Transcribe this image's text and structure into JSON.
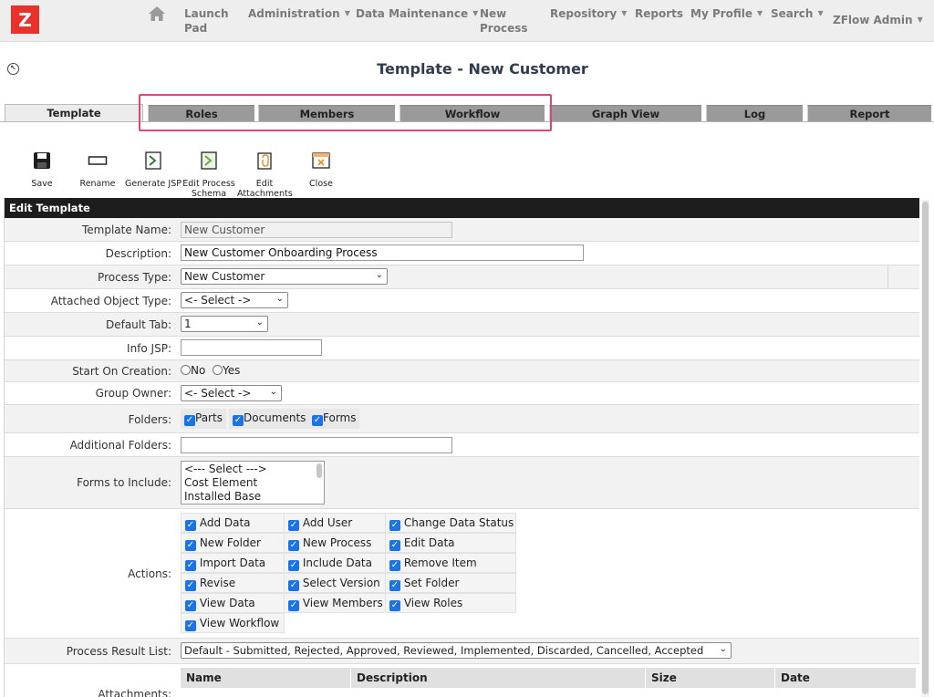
{
  "nav": {
    "logo": "Z",
    "items": [
      {
        "line1": "Launch",
        "line2": "Pad",
        "caret": false
      },
      {
        "line1": "Administration",
        "line2": "",
        "caret": true
      },
      {
        "line1": "Data Maintenance",
        "line2": "",
        "caret": true
      },
      {
        "line1": "New",
        "line2": "Process",
        "caret": false
      },
      {
        "line1": "Repository",
        "line2": "",
        "caret": true
      },
      {
        "line1": "Reports",
        "line2": "",
        "caret": false
      },
      {
        "line1": "My Profile",
        "line2": "",
        "caret": true
      },
      {
        "line1": "Search",
        "line2": "",
        "caret": true
      }
    ],
    "user": "ZFlow Admin"
  },
  "header": {
    "title": "Template - New Customer"
  },
  "tabs": [
    "Template",
    "Roles",
    "Members",
    "Workflow",
    "Graph View",
    "Log",
    "Report"
  ],
  "toolbar": {
    "save": "Save",
    "rename": "Rename",
    "generate_jsp": "Generate JSP",
    "edit_process_schema_1": "Edit Process",
    "edit_process_schema_2": "Schema",
    "edit_attachments_1": "Edit",
    "edit_attachments_2": "Attachments",
    "close": "Close"
  },
  "form": {
    "header": "Edit Template",
    "template_name": {
      "label": "Template Name:",
      "value": "New Customer"
    },
    "description": {
      "label": "Description:",
      "value": "New Customer Onboarding Process"
    },
    "process_type": {
      "label": "Process Type:",
      "value": "New Customer"
    },
    "attached_object_type": {
      "label": "Attached Object Type:",
      "value": "<- Select ->"
    },
    "default_tab": {
      "label": "Default Tab:",
      "value": "1"
    },
    "info_jsp": {
      "label": "Info JSP:",
      "value": ""
    },
    "start_on_creation": {
      "label": "Start On Creation:",
      "no": "No",
      "yes": "Yes"
    },
    "group_owner": {
      "label": "Group Owner:",
      "value": "<- Select ->"
    },
    "folders": {
      "label": "Folders:",
      "parts": "Parts",
      "documents": "Documents",
      "forms": "Forms"
    },
    "additional_folders": {
      "label": "Additional Folders:",
      "value": ""
    },
    "forms_to_include": {
      "label": "Forms to Include:",
      "options": [
        "<--- Select --->",
        "Cost Element",
        "Installed Base"
      ]
    },
    "actions": {
      "label": "Actions:",
      "items": [
        "Add Data",
        "Add User",
        "Change Data Status",
        "New Folder",
        "New Process",
        "Edit Data",
        "Import Data",
        "Include Data",
        "Remove Item",
        "Revise",
        "Select Version",
        "Set Folder",
        "View Data",
        "View Members",
        "View Roles",
        "View Workflow"
      ]
    },
    "process_result_list": {
      "label": "Process Result List:",
      "value": "Default - Submitted, Rejected, Approved, Reviewed, Implemented, Discarded, Cancelled, Accepted"
    },
    "attachments": {
      "label": "Attachments:",
      "columns": [
        "Name",
        "Description",
        "Size",
        "Date"
      ]
    }
  }
}
